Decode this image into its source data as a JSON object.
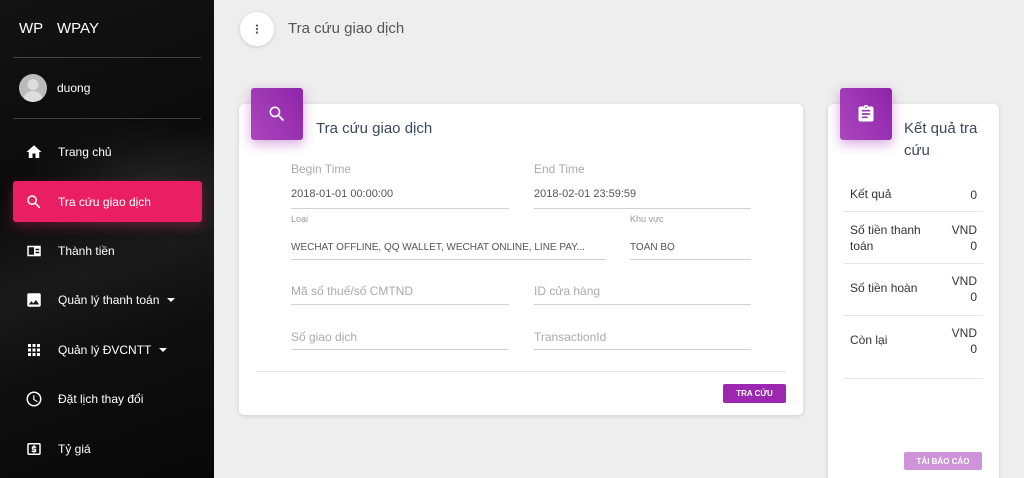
{
  "brand": {
    "mini": "WP",
    "name": "WPAY"
  },
  "user": {
    "name": "duong"
  },
  "sidebar": {
    "items": [
      {
        "label": "Trang chủ",
        "icon": "home-icon"
      },
      {
        "label": "Tra cứu giao dịch",
        "icon": "search-icon",
        "active": true
      },
      {
        "label": "Thành tiền",
        "icon": "receipt-icon"
      },
      {
        "label": "Quản lý thanh toán",
        "icon": "image-icon",
        "has_caret": true
      },
      {
        "label": "Quản lý ĐVCNTT",
        "icon": "apps-icon",
        "has_caret": true
      },
      {
        "label": "Đặt lịch thay đổi",
        "icon": "clock-icon"
      },
      {
        "label": "Tỷ giá",
        "icon": "money-icon"
      }
    ]
  },
  "header": {
    "title": "Tra cứu giao dịch"
  },
  "search_card": {
    "title": "Tra cứu giao dịch",
    "begin_time": {
      "label": "Begin Time",
      "value": "2018-01-01 00:00:00"
    },
    "end_time": {
      "label": "End Time",
      "value": "2018-02-01 23:59:59"
    },
    "type": {
      "label": "Loại",
      "value": "WECHAT OFFLINE, QQ WALLET, WECHAT ONLINE, LINE PAY..."
    },
    "region": {
      "label": "Khu vực",
      "value": "TOÀN BỘ"
    },
    "tax_id": {
      "placeholder": "Mã số thuế/số CMTND"
    },
    "store_id": {
      "placeholder": "ID cửa hàng"
    },
    "txn_no": {
      "placeholder": "Số giao dịch"
    },
    "txn_id": {
      "placeholder": "TransactionId"
    },
    "submit_label": "TRA CỨU"
  },
  "result_card": {
    "title_line1": "Kết quả tra",
    "title_line2": "cứu",
    "rows": [
      {
        "label": "Kết quả",
        "value_line1": "",
        "value_line2": "0"
      },
      {
        "label_line1": "Số tiền thanh",
        "label_line2": "toán",
        "value_line1": "VND",
        "value_line2": "0"
      },
      {
        "label": "Số tiền hoàn",
        "value_line1": "VND",
        "value_line2": "0"
      },
      {
        "label": "Còn lại",
        "value_line1": "VND",
        "value_line2": "0"
      }
    ],
    "download_label": "TẢI BÁO CÁO"
  },
  "colors": {
    "active": "#e91e63",
    "accent": "#9c27b0",
    "accent_light": "#ce93d8"
  }
}
